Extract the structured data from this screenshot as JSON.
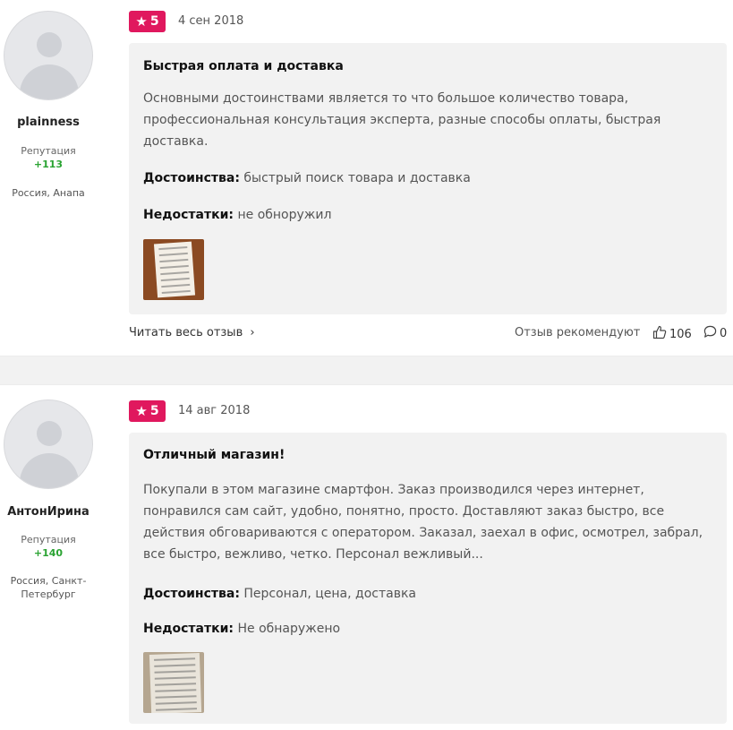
{
  "reviews": [
    {
      "author": "plainness",
      "reputation_label": "Репутация",
      "reputation_value": "+113",
      "location": "Россия, Анапа",
      "rating": "5",
      "date": "4 сен 2018",
      "title": "Быстрая оплата и доставка",
      "text": "Основными достоинствами является то что большое количество товара, профессиональная консультация эксперта, разные способы оплаты, быстрая доставка.",
      "pros_label": "Достоинства:",
      "pros": "быстрый поиск товара и доставка",
      "cons_label": "Недостатки:",
      "cons": "не обноружил",
      "read_more": "Читать весь отзыв",
      "recommends": "Отзыв рекомендуют",
      "likes": "106",
      "comments": "0"
    },
    {
      "author": "АнтонИрина",
      "reputation_label": "Репутация",
      "reputation_value": "+140",
      "location": "Россия, Санкт-Петербург",
      "rating": "5",
      "date": "14 авг 2018",
      "title": "Отличный магазин!",
      "text": "Покупали в этом магазине смартфон. Заказ производился через интернет, понравился сам сайт, удобно, понятно, просто. Доставляют заказ быстро, все действия обговариваются с оператором. Заказал, заехал в офис, осмотрел, забрал, все быстро, вежливо, четко. Персонал вежливый...",
      "pros_label": "Достоинства:",
      "pros": "Персонал, цена, доставка",
      "cons_label": "Недостатки:",
      "cons": "Не обнаружено"
    }
  ],
  "icons": {
    "star": "star-icon",
    "chevron": "chevron-right-icon",
    "like": "thumbs-up-icon",
    "comment": "comment-icon"
  },
  "colors": {
    "rating_badge": "#e0185e",
    "reputation": "#2aa332",
    "card_bg": "#f2f2f2"
  }
}
